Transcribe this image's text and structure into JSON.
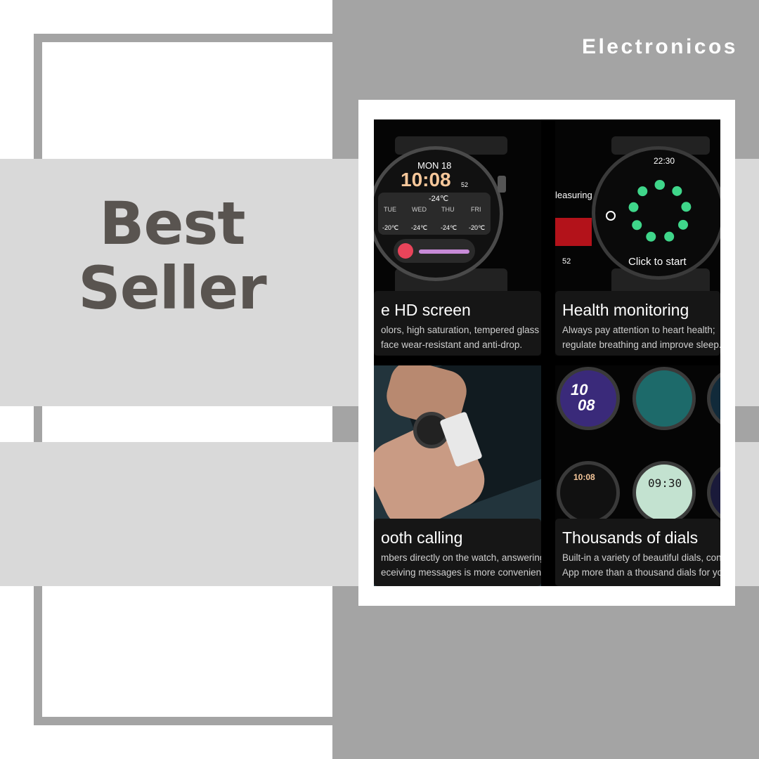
{
  "brand": "Electronicos",
  "headline": {
    "line1": "Best",
    "line2": "Seller"
  },
  "photo": {
    "tiles": [
      {
        "title": "e HD screen",
        "line1": "olors, high saturation, tempered glass",
        "line2": "face wear-resistant and anti-drop."
      },
      {
        "title": "Health monitoring",
        "line1": "Always pay attention to heart health;",
        "line2": "regulate breathing and improve sleep."
      },
      {
        "title": "ooth calling",
        "line1": "mbers directly on the watch, answering",
        "line2": "eceiving messages is more convenient."
      },
      {
        "title": "Thousands of dials",
        "line1": "Built-in a variety of beautiful dials, conn",
        "line2": "App more than a thousand dials for you"
      }
    ],
    "watch1": {
      "date": "MON 18",
      "time": "10:08",
      "sec": "52",
      "temp": "-24℃",
      "days": [
        "TUE",
        "WED",
        "THU",
        "FRI"
      ],
      "temps": [
        "-20℃",
        "-24℃",
        "-24℃",
        "-20℃"
      ]
    },
    "watch2": {
      "time": "22:30",
      "cta": "Click to start",
      "side": "leasuring",
      "reading": "52"
    },
    "dials": {
      "big_time_h": "10",
      "big_time_m": "08",
      "digital": "09:30",
      "mini": "10:08"
    }
  }
}
